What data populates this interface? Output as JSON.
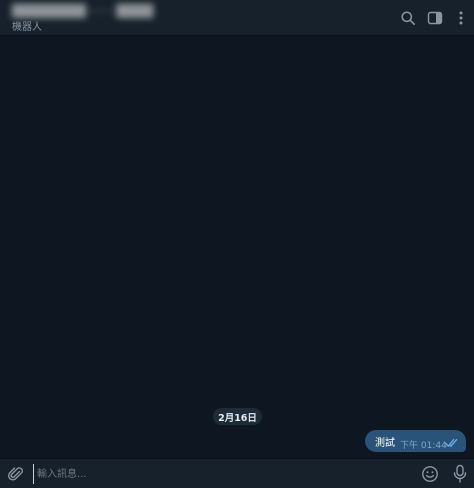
{
  "header": {
    "title": "████████ · · · ████",
    "subtitle": "機器人",
    "icons": [
      "search-icon",
      "sidebar-toggle-icon",
      "more-vertical-icon"
    ]
  },
  "messages": {
    "date_separator": "2月16日",
    "outgoing": [
      {
        "text": "測試",
        "time": "下午 01:44",
        "status": "read"
      }
    ]
  },
  "composer": {
    "placeholder": "輸入訊息...",
    "value": "",
    "icons": [
      "paperclip-icon",
      "emoji-icon",
      "microphone-icon"
    ]
  },
  "colors": {
    "background": "#0e1621",
    "header": "#17212b",
    "bubble": "#2b5278",
    "accent": "#6ab2f2",
    "muted": "#8a96a3"
  }
}
